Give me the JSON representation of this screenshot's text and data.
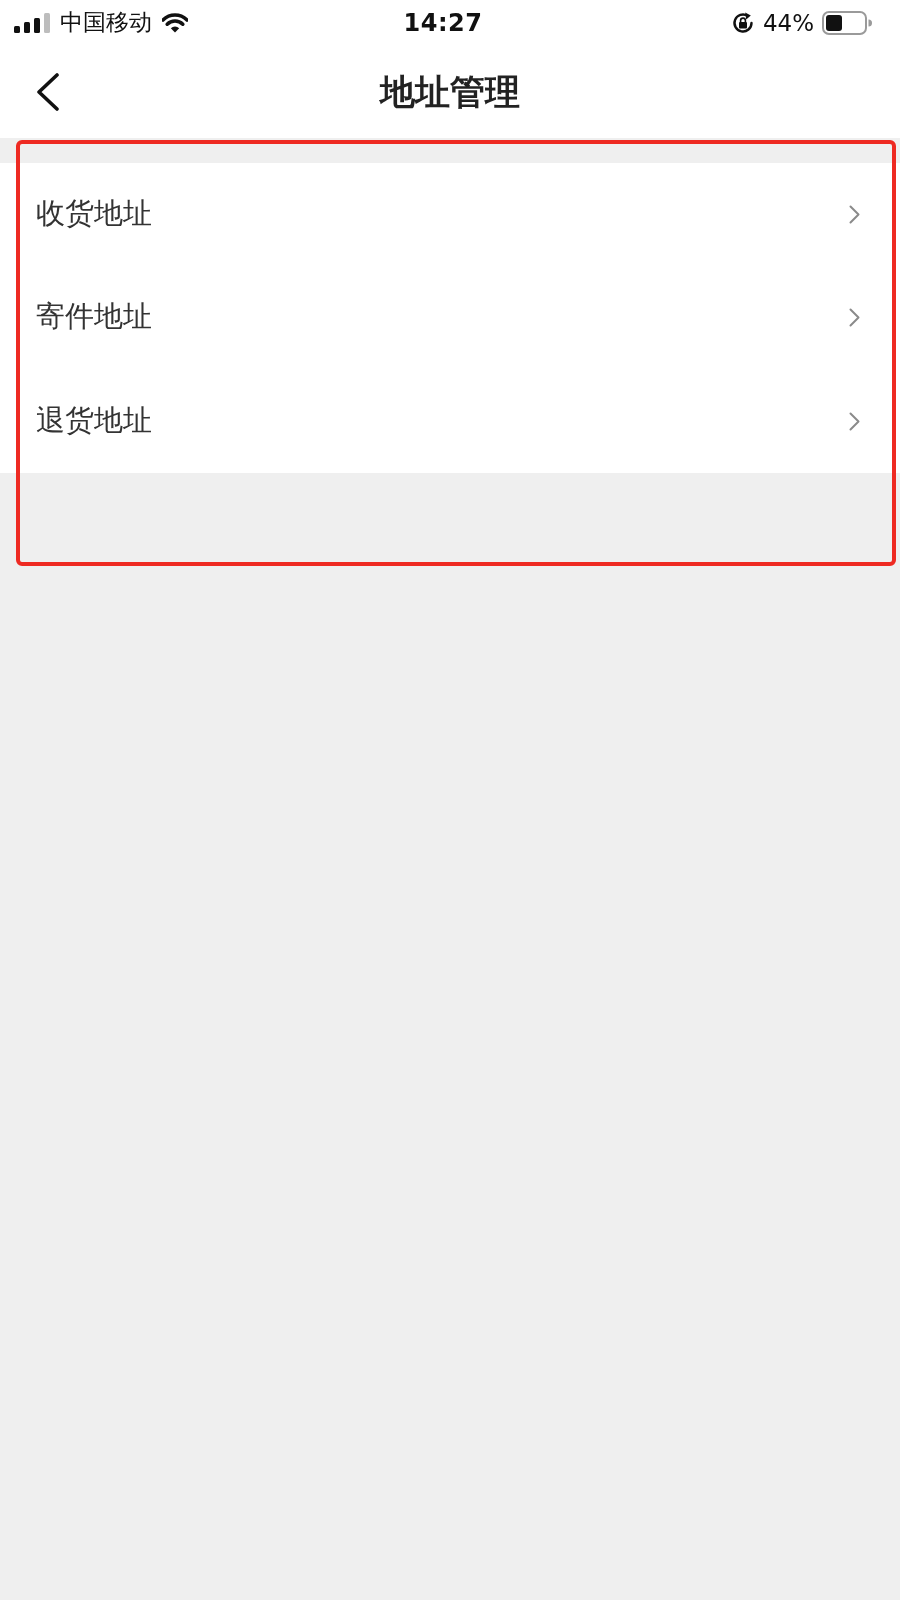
{
  "status_bar": {
    "carrier": "中国移动",
    "time": "14:27",
    "battery": "44%"
  },
  "nav_bar": {
    "title": "地址管理"
  },
  "address_menu": {
    "items": [
      {
        "label": "收货地址"
      },
      {
        "label": "寄件地址"
      },
      {
        "label": "退货地址"
      }
    ]
  }
}
